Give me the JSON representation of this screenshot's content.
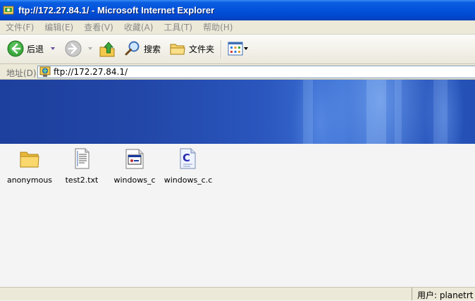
{
  "window": {
    "title": "ftp://172.27.84.1/ - Microsoft Internet Explorer"
  },
  "menu": {
    "items": [
      "文件(F)",
      "编辑(E)",
      "查看(V)",
      "收藏(A)",
      "工具(T)",
      "帮助(H)"
    ]
  },
  "toolbar": {
    "back_label": "后退",
    "search_label": "搜索",
    "folders_label": "文件夹"
  },
  "address": {
    "label": "地址(D)",
    "value": "ftp://172.27.84.1/"
  },
  "files": [
    {
      "name": "anonymous",
      "icon": "folder-icon"
    },
    {
      "name": "test2.txt",
      "icon": "text-file-icon"
    },
    {
      "name": "windows_c",
      "icon": "executable-file-icon"
    },
    {
      "name": "windows_c.c",
      "icon": "c-source-file-icon"
    }
  ],
  "status": {
    "user": "用户: planetrt"
  },
  "colors": {
    "titlebar": "#0453dc",
    "chrome": "#ece9d8",
    "banner": "#2247a8",
    "content_bg": "#f4f4f4"
  }
}
